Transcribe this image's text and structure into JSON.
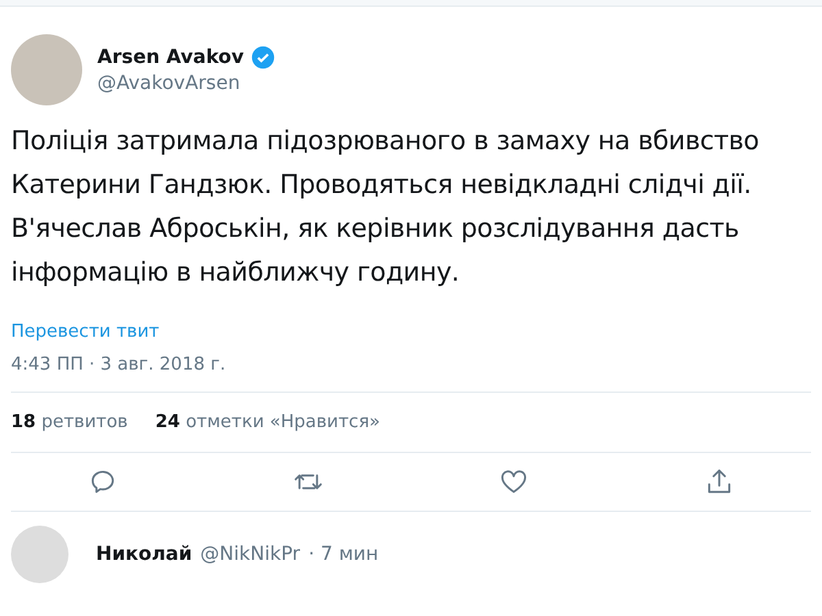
{
  "tweet": {
    "author": {
      "name": "Arsen Avakov",
      "verified": true,
      "handle": "@AvakovArsen"
    },
    "text": "Поліція затримала підозрюваного в замаху на вбивство Катерини Гандзюк. Проводяться невідкладні слідчі дії. В'ячеслав Аброськін, як керівник розслідування дасть інформацію в найближчу годину.",
    "translate_link": "Перевести твит",
    "timestamp": "4:43 ПП · 3 авг. 2018 г.",
    "stats": [
      {
        "count": "18",
        "label": "ретвитов"
      },
      {
        "count": "24",
        "label": "отметки «Нравится»"
      }
    ],
    "actions": [
      {
        "kind": "reply"
      },
      {
        "kind": "retweet"
      },
      {
        "kind": "like"
      },
      {
        "kind": "share"
      }
    ]
  },
  "reply": {
    "name": "Николай",
    "handle": "@NikNikPr",
    "time": "· 7 мин"
  }
}
